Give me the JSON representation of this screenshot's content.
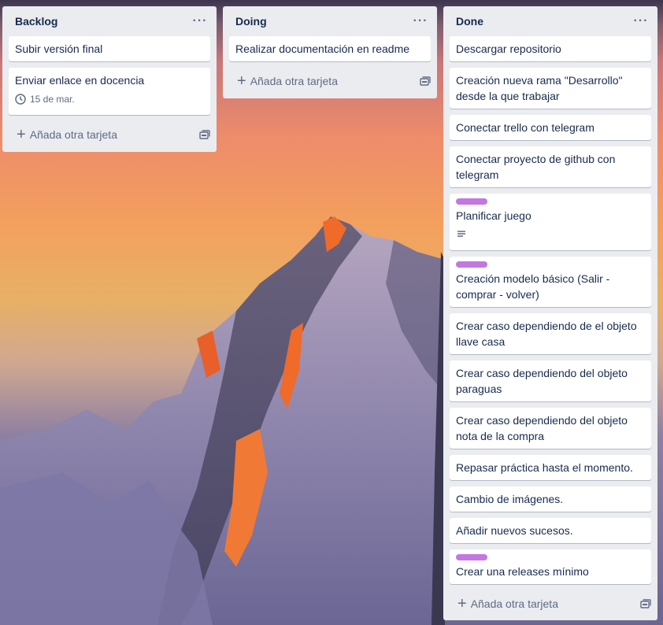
{
  "lists": [
    {
      "title": "Backlog",
      "cards": [
        {
          "text": "Subir versión final"
        },
        {
          "text": "Enviar enlace en docencia",
          "due": "15 de mar."
        }
      ],
      "add_label": "Añada otra tarjeta"
    },
    {
      "title": "Doing",
      "cards": [
        {
          "text": "Realizar documentación en readme"
        }
      ],
      "add_label": "Añada otra tarjeta"
    },
    {
      "title": "Done",
      "cards": [
        {
          "text": "Descargar repositorio"
        },
        {
          "text": "Creación nueva rama \"Desarrollo\" desde la que trabajar"
        },
        {
          "text": "Conectar trello con telegram"
        },
        {
          "text": "Conectar proyecto de github con telegram"
        },
        {
          "text": "Planificar juego",
          "label_color": "#c377e0",
          "has_description": true
        },
        {
          "text": "Creación modelo básico (Salir - comprar - volver)",
          "label_color": "#c377e0"
        },
        {
          "text": "Crear caso dependiendo de el objeto llave casa"
        },
        {
          "text": "Crear caso dependiendo del objeto paraguas"
        },
        {
          "text": "Crear caso dependiendo del objeto nota de la compra"
        },
        {
          "text": "Repasar práctica hasta el momento."
        },
        {
          "text": "Cambio de imágenes."
        },
        {
          "text": "Añadir nuevos sucesos."
        },
        {
          "text": "Crear una releases mínimo",
          "label_color": "#c377e0"
        }
      ],
      "add_label": "Añada otra tarjeta"
    }
  ],
  "icons": {
    "list_menu": "more-horizontal-icon",
    "add": "plus-icon",
    "template": "card-template-icon",
    "due": "clock-icon",
    "description": "description-icon"
  }
}
